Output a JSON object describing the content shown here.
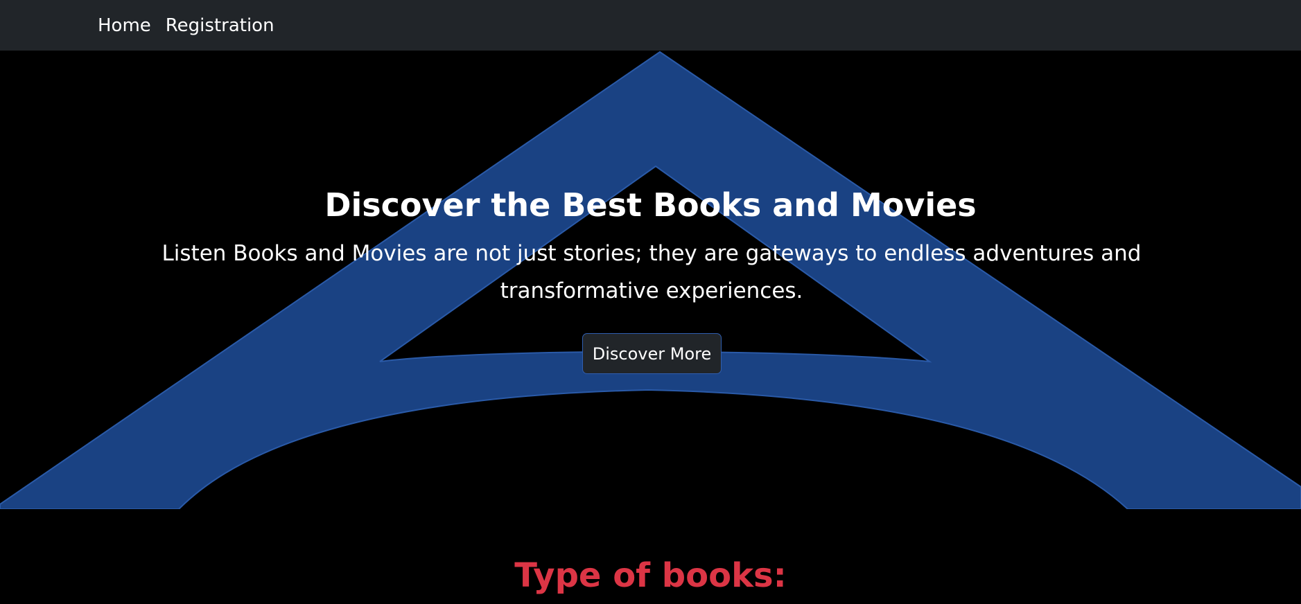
{
  "nav": {
    "items": [
      {
        "label": "Home"
      },
      {
        "label": "Registration"
      }
    ]
  },
  "hero": {
    "title": "Discover the Best Books and Movies",
    "description": "Listen Books and Movies are not just stories; they are gateways to endless adventures and transformative experiences.",
    "button_label": "Discover More",
    "background_logo_icon": "arch-logo-icon"
  },
  "section": {
    "title": "Type of books:"
  },
  "colors": {
    "navbar": "#212529",
    "background": "#000000",
    "logo": "#1a4283",
    "button_border": "#2f5eb0",
    "accent_red": "#dc3545",
    "text": "#ffffff"
  }
}
